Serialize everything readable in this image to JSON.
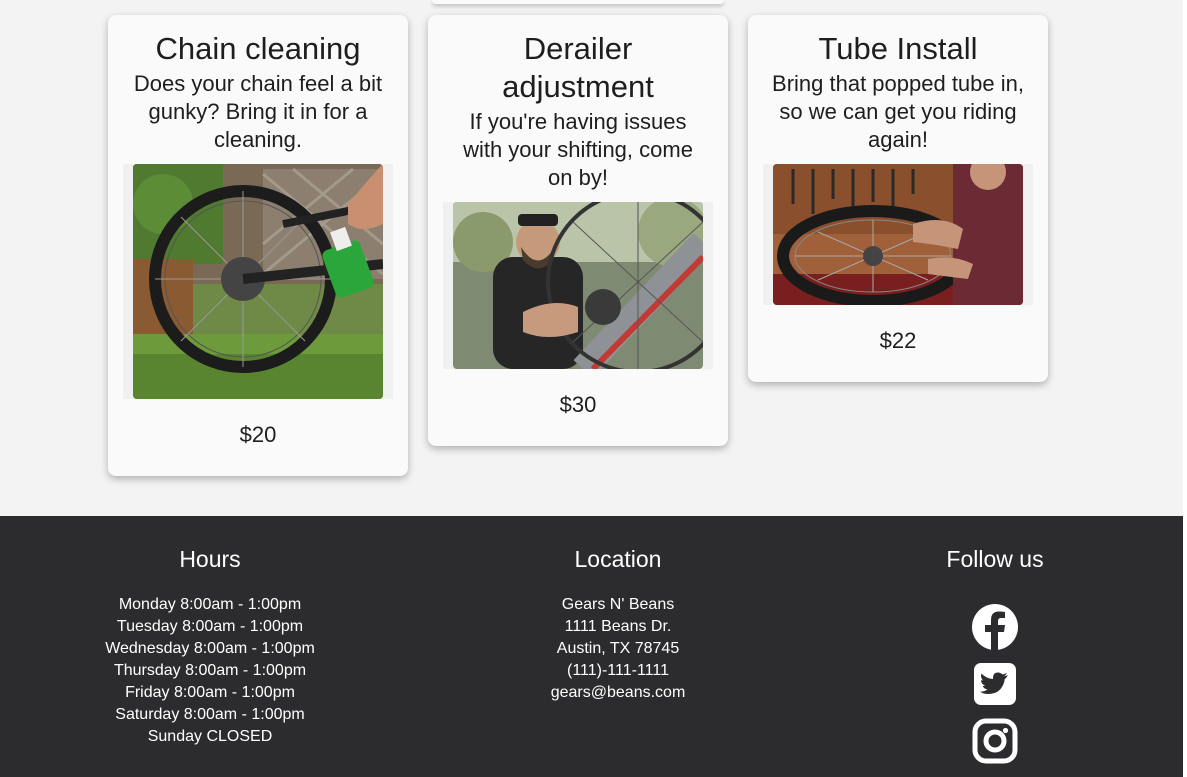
{
  "cards": [
    {
      "title": "Chain cleaning",
      "description": "Does your chain feel a bit gunky? Bring it in for a cleaning.",
      "price": "$20"
    },
    {
      "title": "Derailer adjustment",
      "description": "If you're having issues with your shifting, come on by!",
      "price": "$30"
    },
    {
      "title": "Tube Install",
      "description": "Bring that popped tube in, so we can get you riding again!",
      "price": "$22"
    }
  ],
  "footer": {
    "hours": {
      "heading": "Hours",
      "lines": [
        "Monday 8:00am - 1:00pm",
        "Tuesday 8:00am - 1:00pm",
        "Wednesday 8:00am - 1:00pm",
        "Thursday 8:00am - 1:00pm",
        "Friday 8:00am - 1:00pm",
        "Saturday 8:00am - 1:00pm",
        "Sunday CLOSED"
      ]
    },
    "location": {
      "heading": "Location",
      "lines": [
        "Gears N' Beans",
        "1111 Beans Dr.",
        "Austin, TX 78745",
        "(111)-111-1111",
        "gears@beans.com"
      ]
    },
    "follow": {
      "heading": "Follow us",
      "icons": [
        "facebook-icon",
        "twitter-icon",
        "instagram-icon"
      ]
    }
  },
  "colors": {
    "page_background": "#f3f3f3",
    "card_background": "#fafafa",
    "footer_background": "#2c2c2e",
    "footer_text": "#ffffff"
  }
}
